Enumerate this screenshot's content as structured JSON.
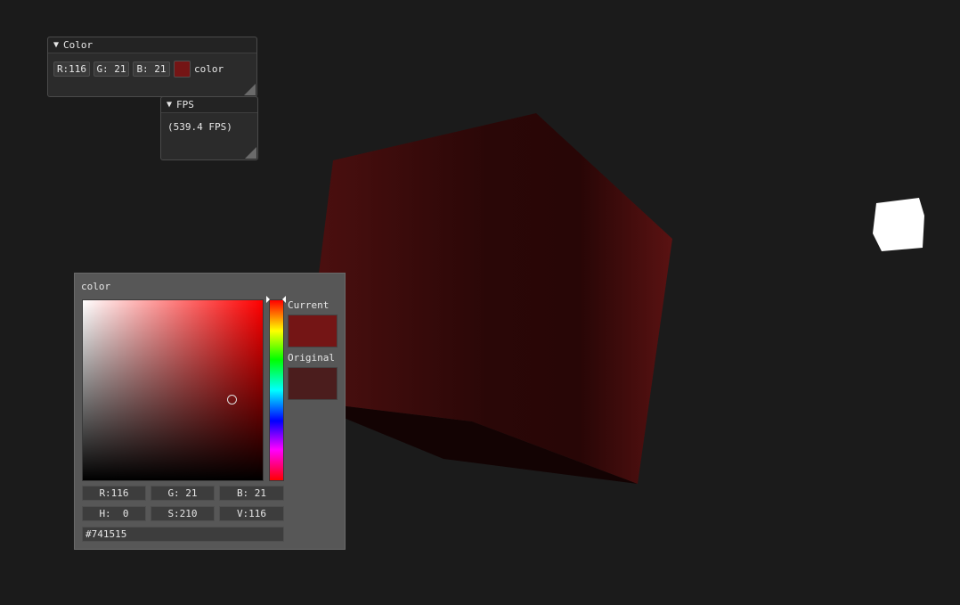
{
  "colors": {
    "background": "#1b1b1b",
    "current": "#741515",
    "original": "#4b1d1d"
  },
  "color_window": {
    "title": "Color",
    "r": "R:116",
    "g": "G: 21",
    "b": "B: 21",
    "label": "color"
  },
  "fps_window": {
    "title": "FPS",
    "text": "(539.4 FPS)"
  },
  "picker": {
    "title": "color",
    "current_label": "Current",
    "original_label": "Original",
    "r": "R:116",
    "g": "G: 21",
    "b": "B: 21",
    "h": "H:  0",
    "s": "S:210",
    "v": "V:116",
    "hex": "#741515"
  }
}
